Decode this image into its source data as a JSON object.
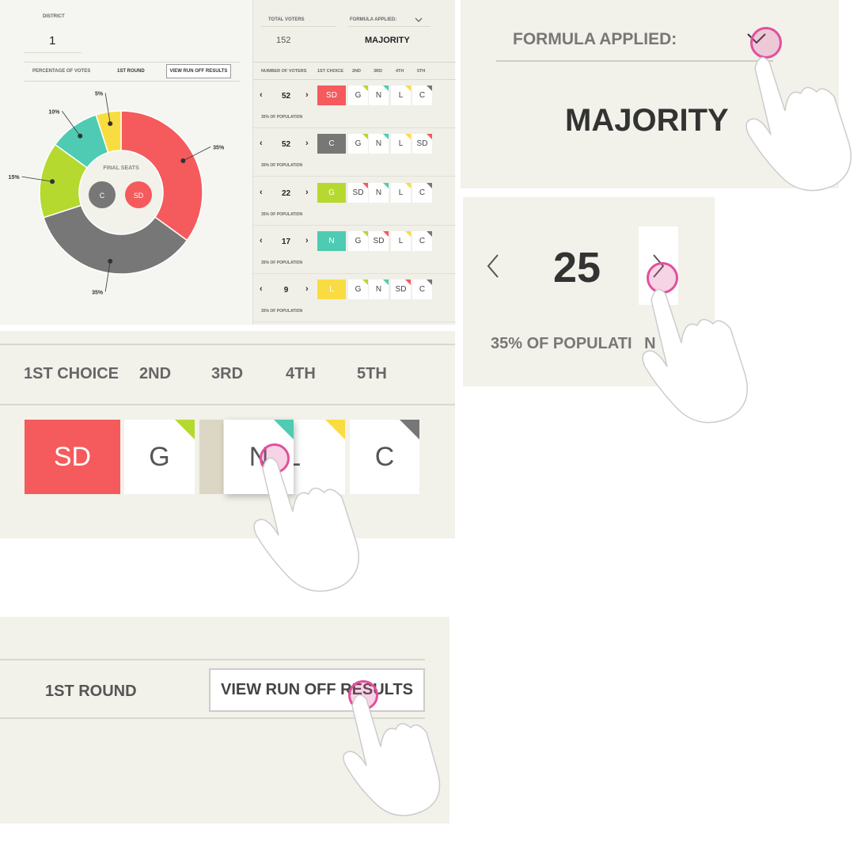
{
  "district": {
    "label": "DISTRICT",
    "value": "1"
  },
  "totals": {
    "voters_label": "TOTAL VOTERS",
    "voters_value": "152",
    "formula_label": "FORMULA APPLIED:",
    "formula_value": "MAJORITY"
  },
  "tabs": {
    "percentage_label": "PERCENTAGE OF VOTES",
    "round_label": "1ST ROUND",
    "runoff_button": "VIEW RUN OFF RESULTS"
  },
  "chart_data": {
    "type": "pie",
    "center_label": "FINAL SEATS",
    "seats": [
      "C",
      "SD"
    ],
    "slices": [
      {
        "label": "SD",
        "value": 35,
        "color": "#f55a5c",
        "text": "35%"
      },
      {
        "label": "C",
        "value": 35,
        "color": "#777777",
        "text": "35%"
      },
      {
        "label": "G",
        "value": 15,
        "color": "#b6d930",
        "text": "15%"
      },
      {
        "label": "N",
        "value": 10,
        "color": "#4ecbb2",
        "text": "10%"
      },
      {
        "label": "L",
        "value": 5,
        "color": "#f9dc41",
        "text": "5%"
      }
    ]
  },
  "ballot_header": {
    "votes": "NUMBER OF VOTERS",
    "c1": "1ST CHOICE",
    "c2": "2ND",
    "c3": "3RD",
    "c4": "4TH",
    "c5": "5TH"
  },
  "ballots": [
    {
      "votes": "52",
      "pop": "35% OF POPULATION",
      "choices": [
        "SD",
        "G",
        "N",
        "L",
        "C"
      ]
    },
    {
      "votes": "52",
      "pop": "35% OF POPULATION",
      "choices": [
        "C",
        "G",
        "N",
        "L",
        "SD"
      ]
    },
    {
      "votes": "22",
      "pop": "35% OF POPULATION",
      "choices": [
        "G",
        "SD",
        "N",
        "L",
        "C"
      ]
    },
    {
      "votes": "17",
      "pop": "35% OF POPULATION",
      "choices": [
        "N",
        "G",
        "SD",
        "L",
        "C"
      ]
    },
    {
      "votes": "9",
      "pop": "35% OF POPULATION",
      "choices": [
        "L",
        "G",
        "N",
        "SD",
        "C"
      ]
    }
  ],
  "colors": {
    "SD": "#f55a5c",
    "C": "#777777",
    "G": "#b6d930",
    "N": "#4ecbb2",
    "L": "#f9dc41"
  },
  "zoom_formula": {
    "label": "FORMULA APPLIED:",
    "value": "MAJORITY",
    "icon": "chevron-down-icon"
  },
  "zoom_stepper": {
    "value": "25",
    "pop": "35% OF POPULATI",
    "pop_tail": "N"
  },
  "zoom_choice": {
    "headers": [
      "1ST CHOICE",
      "2ND",
      "3RD",
      "4TH",
      "5TH"
    ],
    "cells": [
      "SD",
      "G",
      "N",
      "L",
      "C"
    ]
  },
  "zoom_round": {
    "round": "1ST ROUND",
    "button": "VIEW RUN OFF RESULTS"
  }
}
